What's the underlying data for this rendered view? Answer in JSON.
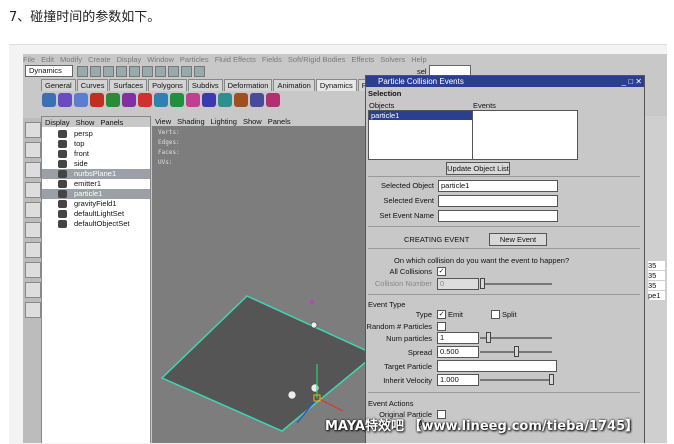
{
  "caption": "7、碰撞时间的参数如下。",
  "menubar": [
    "File",
    "Edit",
    "Modify",
    "Create",
    "Display",
    "Window",
    "Particles",
    "Fluid Effects",
    "Fields",
    "Soft/Rigid Bodies",
    "Effects",
    "Solvers",
    "Help"
  ],
  "statusline": {
    "mode": "Dynamics",
    "sel_label": "sel"
  },
  "tabs": [
    "General",
    "Curves",
    "Surfaces",
    "Polygons",
    "Subdivs",
    "Deformation",
    "Animation",
    "Dynamics",
    "Rendering",
    "Pai"
  ],
  "active_tab": "Dynamics",
  "outliner": {
    "menu": [
      "Display",
      "Show",
      "Panels"
    ],
    "items": [
      {
        "label": "persp",
        "selected": false
      },
      {
        "label": "top",
        "selected": false
      },
      {
        "label": "front",
        "selected": false
      },
      {
        "label": "side",
        "selected": false
      },
      {
        "label": "nurbsPlane1",
        "selected": true
      },
      {
        "label": "emitter1",
        "selected": false
      },
      {
        "label": "particle1",
        "selected": true
      },
      {
        "label": "gravityField1",
        "selected": false
      },
      {
        "label": "defaultLightSet",
        "selected": false
      },
      {
        "label": "defaultObjectSet",
        "selected": false
      }
    ]
  },
  "viewport": {
    "menu": [
      "View",
      "Shading",
      "Lighting",
      "Show",
      "Panels"
    ],
    "hud": [
      "Verts:",
      "Edges:",
      "Faces:",
      "UVs:"
    ]
  },
  "dialog": {
    "title": "Particle Collision Events",
    "section_selection": "Selection",
    "col_objects": "Objects",
    "col_events": "Events",
    "object_item": "particle1",
    "update_button": "Update Object List",
    "selected_object_label": "Selected Object",
    "selected_object_value": "particle1",
    "selected_event_label": "Selected Event",
    "set_event_name_label": "Set Event Name",
    "creating_event": "CREATING EVENT",
    "new_event_button": "New Event",
    "question": "On which collision do you want the event to happen?",
    "all_collisions_label": "All Collisions",
    "collision_number_label": "Collision Number",
    "collision_number_value": "0",
    "event_type_label": "Event Type",
    "type_label": "Type",
    "emit_label": "Emit",
    "split_label": "Split",
    "random_particles_label": "Random # Particles",
    "num_particles_label": "Num particles",
    "num_particles_value": "1",
    "spread_label": "Spread",
    "spread_value": "0.500",
    "target_particle_label": "Target Particle",
    "inherit_velocity_label": "Inherit Velocity",
    "inherit_velocity_value": "1.000",
    "event_actions_label": "Event Actions",
    "original_dies_label": "Original Particle Dies"
  },
  "right_values": [
    "35",
    "35",
    "35",
    "pe1"
  ],
  "watermark": "MAYA特效吧 【www.lineeg.com/tieba/1745】",
  "colors": {
    "title_bar": "#2a3f8f",
    "plane": "#555555",
    "plane_edge": "#3fd7b2",
    "selection": "#2a3f8f"
  }
}
